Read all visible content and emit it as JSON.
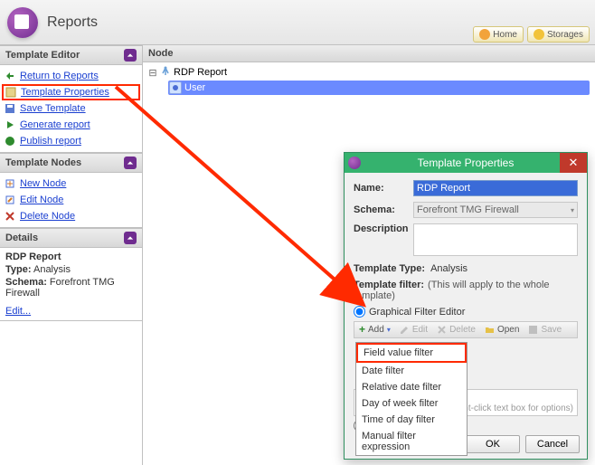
{
  "header": {
    "title": "Reports",
    "home": "Home",
    "storages": "Storages"
  },
  "panels": {
    "editor": {
      "title": "Template Editor",
      "return": "Return to Reports",
      "props": "Template Properties",
      "save": "Save Template",
      "gen": "Generate report",
      "pub": "Publish report"
    },
    "nodes": {
      "title": "Template Nodes",
      "new": "New Node",
      "edit": "Edit Node",
      "del": "Delete Node"
    },
    "details": {
      "title": "Details",
      "name": "RDP Report",
      "typeLabel": "Type:",
      "typeVal": "Analysis",
      "schemaLabel": "Schema:",
      "schemaVal": "Forefront TMG Firewall",
      "edit": "Edit..."
    }
  },
  "tree": {
    "header": "Node",
    "root": "RDP Report",
    "child": "User"
  },
  "dialog": {
    "title": "Template Properties",
    "nameLabel": "Name:",
    "nameVal": "RDP Report",
    "schemaLabel": "Schema:",
    "schemaVal": "Forefront TMG Firewall",
    "descLabel": "Description",
    "ttypeLabel": "Template Type:",
    "ttypeVal": "Analysis",
    "tfiltLabel": "Template filter:",
    "tfiltNote": "(This will apply to the whole template)",
    "radioGraphical": "Graphical Filter Editor",
    "toolbar": {
      "add": "Add",
      "edit": "Edit",
      "del": "Delete",
      "open": "Open",
      "save": "Save"
    },
    "dropdown": [
      "Field value filter",
      "Date filter",
      "Relative date filter",
      "Day of week filter",
      "Time of day filter",
      "Manual filter expression"
    ],
    "hint": "(right-click text box for options)",
    "ok": "OK",
    "cancel": "Cancel"
  }
}
